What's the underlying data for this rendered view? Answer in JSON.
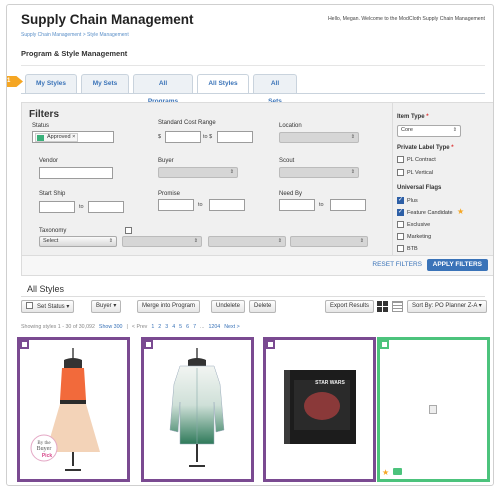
{
  "app": {
    "title": "Supply Chain Management",
    "welcome": "Hello, Megan. Welcome to the ModCloth Supply Chain Management"
  },
  "breadcrumb": "Supply Chain Management > Style Management",
  "page_title": "Program & Style Management",
  "step_badge": "1",
  "tabs": [
    {
      "label": "My Styles"
    },
    {
      "label": "My Sets"
    },
    {
      "label": "All Programs"
    },
    {
      "label": "All Styles"
    },
    {
      "label": "All Sets"
    }
  ],
  "filters": {
    "title": "Filters",
    "status_label": "Status",
    "status_chip": "Approved",
    "cost_label": "Standard Cost Range",
    "currency": "$",
    "to_dollar": "to $",
    "location_label": "Location",
    "vendor_label": "Vendor",
    "buyer_label": "Buyer",
    "scout_label": "Scout",
    "start_ship_label": "Start Ship",
    "promise_label": "Promise",
    "need_by_label": "Need By",
    "to": "to",
    "taxonomy_label": "Taxonomy",
    "taxonomy_value": "Select",
    "item_type_label": "Item Type",
    "item_type_value": "Core",
    "private_label_label": "Private Label Type",
    "required_mark": "*",
    "private_label_options": [
      {
        "label": "PL Contract",
        "checked": false
      },
      {
        "label": "PL Vertical",
        "checked": false
      }
    ],
    "universal_flags_label": "Universal Flags",
    "flags": [
      {
        "label": "Plus",
        "checked": true
      },
      {
        "label": "Feature Candidate",
        "checked": true
      },
      {
        "label": "Exclusive",
        "checked": false
      },
      {
        "label": "Marketing",
        "checked": false
      },
      {
        "label": "BTB",
        "checked": false
      }
    ],
    "reset": "RESET FILTERS",
    "apply": "APPLY FILTERS"
  },
  "results": {
    "title": "All Styles",
    "set_status": "Set Status",
    "buyer": "Buyer",
    "merge": "Merge into Program",
    "undelete": "Undelete",
    "delete": "Delete",
    "export": "Export Results",
    "sort": "Sort By: PO Planner Z-A",
    "showing": "Showing styles 1 - 30 of 30,092",
    "show300": "Show 300",
    "prev": "< Prev",
    "pages": [
      "1",
      "2",
      "3",
      "4",
      "5",
      "6",
      "7",
      "...",
      "1204"
    ],
    "next": "Next >"
  },
  "cards": [
    {
      "badge_line1": "By the",
      "badge_line2": "Buyer",
      "badge_line3": "Pick"
    },
    {},
    {
      "book_title": "STAR WARS"
    },
    {}
  ],
  "colors": {
    "purple": "#7a4a91",
    "green": "#4cc37c",
    "link": "#3a73b8",
    "orange": "#f5a623"
  }
}
